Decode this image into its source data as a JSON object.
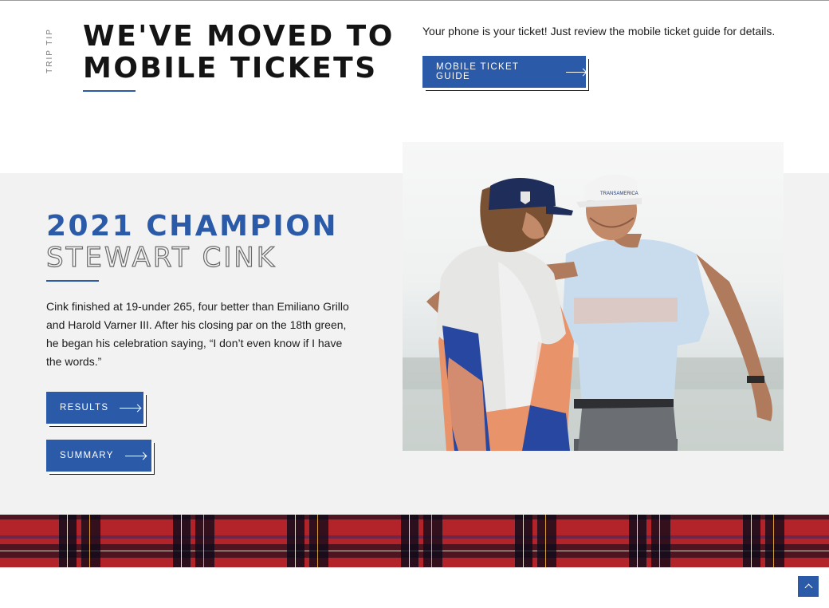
{
  "trip_tip": {
    "label": "Trip Tip",
    "title": "WE'VE MOVED TO\nMOBILE TICKETS",
    "text": "Your phone is your ticket! Just review the mobile ticket guide for details.",
    "button_label": "MOBILE TICKET GUIDE"
  },
  "champion": {
    "heading": "2021 CHAMPION",
    "name": "STEWART CINK",
    "description": "Cink finished at 19-under 265, four better than Emiliano Grillo and Harold Varner III. After his closing par on the 18th green, he began his celebration saying, “I don’t even know if I have the words.”",
    "results_label": "RESULTS",
    "summary_label": "SUMMARY",
    "photo_logo_text": "TRANSAMERICA"
  },
  "colors": {
    "accent_blue": "#2a5aa8",
    "section_gray": "#f2f2f2",
    "plaid_red": "#b3232a"
  },
  "icons": {
    "button_arrow": "arrow-right-icon",
    "back_to_top": "chevron-up-icon"
  }
}
